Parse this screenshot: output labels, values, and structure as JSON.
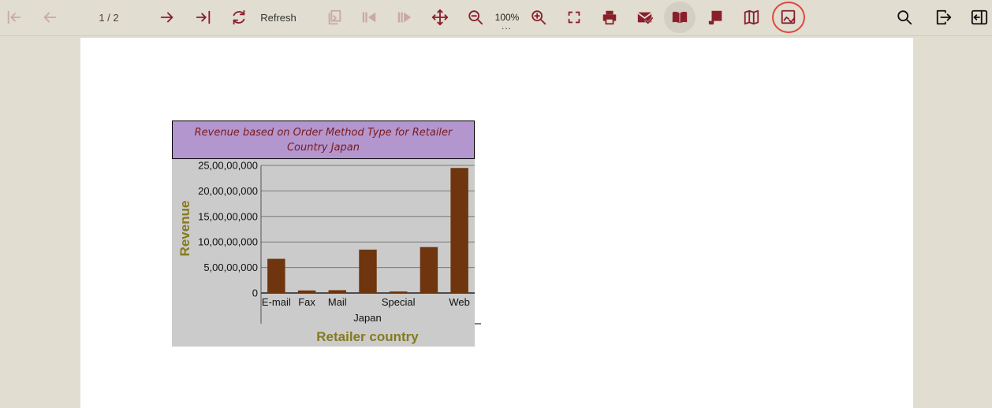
{
  "toolbar": {
    "page_indicator": "1 / 2",
    "refresh_label": "Refresh",
    "zoom_level": "100%",
    "zoom_more": "...",
    "icons": {
      "first_page": "first-page-icon",
      "previous_page": "previous-page-icon",
      "next_page": "next-page-icon",
      "last_page": "last-page-icon",
      "refresh": "refresh-icon",
      "copy": "copy-icon",
      "step_back": "step-back-icon",
      "step_forward": "step-forward-icon",
      "pan": "pan-icon",
      "zoom_out": "zoom-out-icon",
      "zoom_in": "zoom-in-icon",
      "fit_page": "fit-page-icon",
      "print": "print-icon",
      "email": "email-icon",
      "book": "book-icon",
      "scroll": "scroll-icon",
      "map": "map-icon",
      "extract": "extract-icon",
      "search": "search-icon",
      "exit": "exit-icon",
      "collapse": "collapse-panel-icon"
    }
  },
  "chart_data": {
    "type": "bar",
    "title": "Revenue based on Order Method Type for Retailer Country Japan",
    "ylabel": "Revenue",
    "xlabel": "Retailer country",
    "group_label": "Japan",
    "categories": [
      "E-mail",
      "Fax",
      "Mail",
      "",
      "Special",
      "",
      "Web"
    ],
    "values": [
      67000000,
      5000000,
      5500000,
      85000000,
      3000000,
      90000000,
      245000000
    ],
    "ylim": [
      0,
      250000000
    ],
    "yticks": [
      0,
      50000000,
      100000000,
      150000000,
      200000000,
      250000000
    ],
    "ytick_labels": [
      "0",
      "5,00,00,000",
      "10,00,00,000",
      "15,00,00,000",
      "20,00,00,000",
      "25,00,00,000"
    ],
    "bar_color": "#6e350e",
    "background": "#cbcbcb",
    "header_color": "#b496cf",
    "grid": true
  }
}
